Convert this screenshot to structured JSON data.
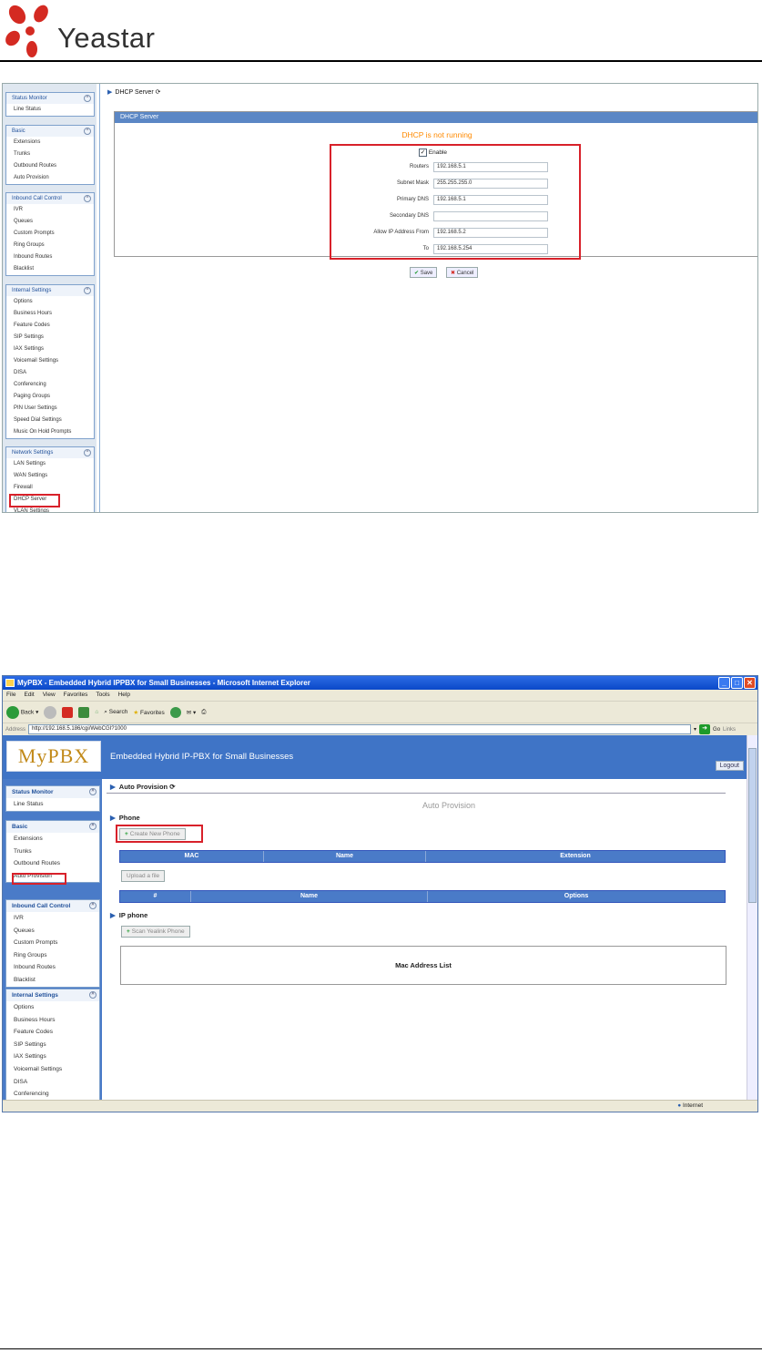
{
  "logo": {
    "text": "Yeastar"
  },
  "shot1": {
    "breadcrumb": "DHCP Server",
    "panel_title": "DHCP Server",
    "status": "DHCP is not running",
    "enable_label": "Enable",
    "fields": [
      {
        "label": "Routers",
        "value": "192.168.5.1"
      },
      {
        "label": "Subnet Mask",
        "value": "255.255.255.0"
      },
      {
        "label": "Primary DNS",
        "value": "192.168.5.1"
      },
      {
        "label": "Secondary DNS",
        "value": ""
      },
      {
        "label": "Allow IP Address From",
        "value": "192.168.5.2"
      },
      {
        "label": "To",
        "value": "192.168.5.254"
      }
    ],
    "save": "Save",
    "cancel": "Cancel",
    "sidebar": [
      {
        "title": "Status Monitor",
        "items": [
          "Line Status"
        ]
      },
      {
        "title": "Basic",
        "items": [
          "Extensions",
          "Trunks",
          "Outbound Routes",
          "Auto Provision"
        ]
      },
      {
        "title": "Inbound Call Control",
        "items": [
          "IVR",
          "Queues",
          "Custom Prompts",
          "Ring Groups",
          "Inbound Routes",
          "Blacklist"
        ]
      },
      {
        "title": "Internal Settings",
        "items": [
          "Options",
          "Business Hours",
          "Feature Codes",
          "SIP Settings",
          "IAX Settings",
          "Voicemail Settings",
          "DISA",
          "Conferencing",
          "Paging Groups",
          "PIN User Settings",
          "Speed Dial Settings",
          "Music On Hold Prompts"
        ]
      },
      {
        "title": "Network Settings",
        "items": [
          "LAN Settings",
          "WAN Settings",
          "Firewall",
          "DHCP Server",
          "VLAN Settings"
        ]
      }
    ]
  },
  "shot2": {
    "window_title": "MyPBX - Embedded Hybrid IPPBX for Small Businesses - Microsoft Internet Explorer",
    "menu": [
      "File",
      "Edit",
      "View",
      "Favorites",
      "Tools",
      "Help"
    ],
    "toolbar": {
      "back": "Back",
      "search": "Search",
      "favorites": "Favorites"
    },
    "address_label": "Address",
    "url": "http://192.168.5.186/cgi/WebCGI?1000",
    "go": "Go",
    "links": "Links",
    "logo": "MyPBX",
    "tagline": "Embedded Hybrid IP-PBX for Small Businesses",
    "logout": "Logout",
    "breadcrumb": "Auto Provision",
    "page_title": "Auto Provision",
    "phone_section": "Phone",
    "create_btn": "Create New Phone",
    "phone_cols": [
      "MAC",
      "Name",
      "Extension"
    ],
    "upload_btn": "Upload a file",
    "file_cols": [
      "#",
      "Name",
      "Options"
    ],
    "ip_section": "IP phone",
    "scan_btn": "Scan Yealink Phone",
    "mac_list": "Mac Address List",
    "status_internet": "Internet",
    "sidebar": [
      {
        "title": "Status Monitor",
        "items": [
          "Line Status"
        ]
      },
      {
        "title": "Basic",
        "items": [
          "Extensions",
          "Trunks",
          "Outbound Routes",
          "Auto Provision"
        ]
      },
      {
        "title": "Inbound Call Control",
        "items": [
          "IVR",
          "Queues",
          "Custom Prompts",
          "Ring Groups",
          "Inbound Routes",
          "Blacklist"
        ]
      },
      {
        "title": "Internal Settings",
        "items": [
          "Options",
          "Business Hours",
          "Feature Codes",
          "SIP Settings",
          "IAX Settings",
          "Voicemail Settings",
          "DISA",
          "Conferencing"
        ]
      }
    ]
  }
}
